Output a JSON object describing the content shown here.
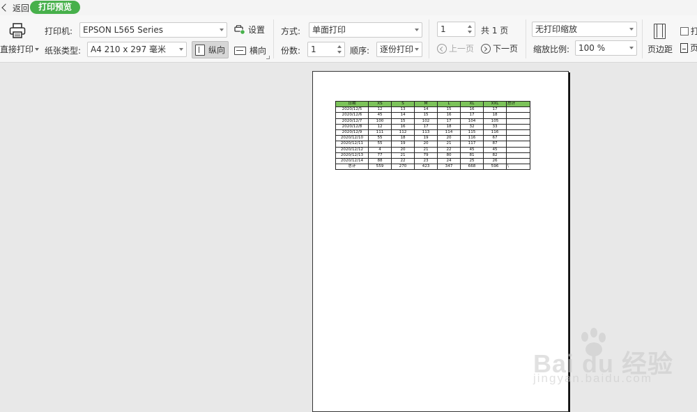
{
  "topbar": {
    "back_label": "返回",
    "active_tab": "打印预览"
  },
  "ribbon": {
    "direct_print_label": "直接打印",
    "printer": {
      "label": "打印机:",
      "value": "EPSON L565 Series"
    },
    "paper_type": {
      "label": "纸张类型:",
      "value": "A4 210 x 297 毫米"
    },
    "settings_label": "设置",
    "portrait_label": "纵向",
    "landscape_label": "横向",
    "mode": {
      "label": "方式:",
      "value": "单面打印"
    },
    "copies": {
      "label": "份数:",
      "value": "1"
    },
    "order": {
      "label": "顺序:",
      "value": "逐份打印"
    },
    "page_input": "1",
    "total_pages": "共 1 页",
    "prev_page_label": "上一页",
    "next_page_label": "下一页",
    "scaling": {
      "value": "无打印缩放"
    },
    "zoom": {
      "label": "缩放比例:",
      "value": "100 %"
    },
    "margin_label": "页边距",
    "checkbox_label_partial": "打",
    "page_label_partial": "页"
  },
  "sheet": {
    "headers": [
      "日期",
      "XS",
      "S",
      "M",
      "L",
      "XL",
      "XXL",
      "总计"
    ],
    "rows": [
      [
        "2020/12/5",
        "12",
        "13",
        "14",
        "15",
        "16",
        "17",
        ""
      ],
      [
        "2020/12/6",
        "45",
        "14",
        "15",
        "16",
        "17",
        "18",
        ""
      ],
      [
        "2020/12/7",
        "100",
        "15",
        "102",
        "17",
        "104",
        "105",
        ""
      ],
      [
        "2020/12/8",
        "12",
        "16",
        "17",
        "18",
        "32",
        "33",
        ""
      ],
      [
        "2020/12/9",
        "111",
        "112",
        "113",
        "114",
        "115",
        "116",
        ""
      ],
      [
        "2020/12/10",
        "55",
        "18",
        "19",
        "20",
        "116",
        "67",
        ""
      ],
      [
        "2020/12/11",
        "55",
        "19",
        "20",
        "21",
        "117",
        "87",
        ""
      ],
      [
        "2020/12/12",
        "4",
        "20",
        "21",
        "22",
        "45",
        "45",
        ""
      ],
      [
        "2020/12/13",
        "77",
        "21",
        "79",
        "80",
        "81",
        "82",
        ""
      ],
      [
        "2020/12/14",
        "88",
        "22",
        "23",
        "24",
        "25",
        "26",
        ""
      ]
    ],
    "total_row": [
      "总计",
      "559",
      "270",
      "423",
      "347",
      "668",
      "596",
      "\\"
    ]
  },
  "watermark": {
    "brand": "Bai du 经验",
    "url": "jingyan.baidu.com"
  },
  "colors": {
    "accent_green": "#47b04b",
    "header_green": "#7cc35a"
  }
}
